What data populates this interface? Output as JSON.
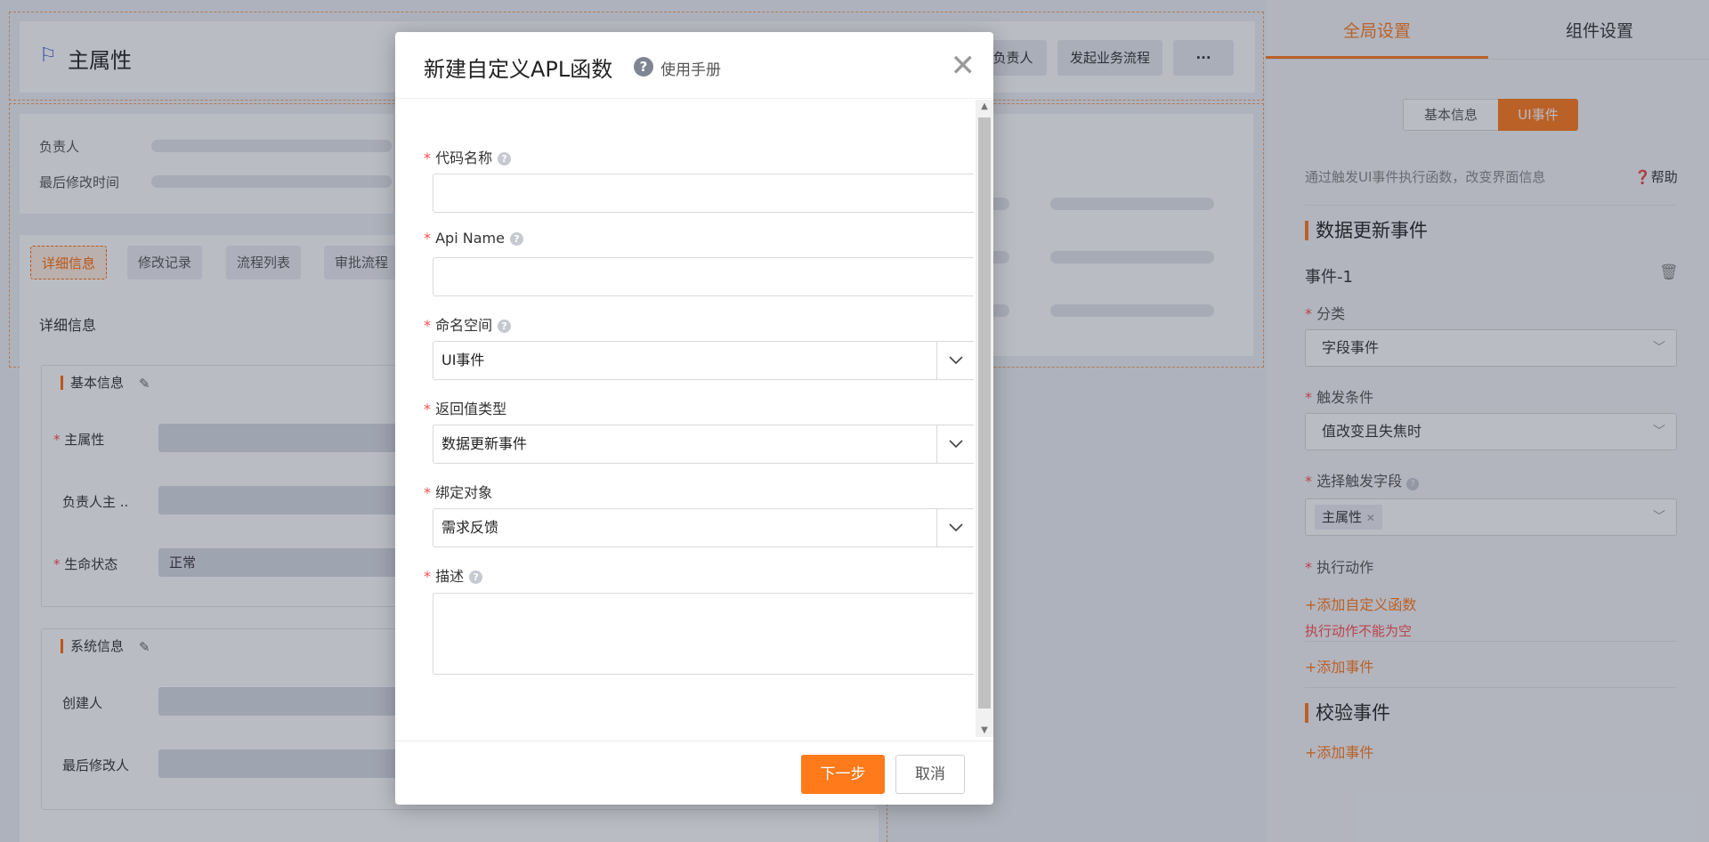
{
  "header": {
    "title": "主属性",
    "buttons": [
      "负责人",
      "发起业务流程",
      "···"
    ]
  },
  "info": {
    "owner_label": "负责人",
    "modified_label": "最后修改时间"
  },
  "detail": {
    "tabs": [
      "详细信息",
      "修改记录",
      "流程列表",
      "审批流程"
    ],
    "heading": "详细信息",
    "basic_section": "基本信息",
    "basic_fields": [
      "主属性",
      "负责人主 ..",
      "生命状态"
    ],
    "status_value": "正常",
    "system_section": "系统信息",
    "system_fields": [
      "创建人",
      "最后修改人"
    ]
  },
  "right_panel": {
    "tabs": [
      "全局设置",
      "组件设置"
    ],
    "segments": [
      "基本信息",
      "UI事件"
    ],
    "hint": "通过触发UI事件执行函数，改变界面信息",
    "help": "帮助",
    "data_update_title": "数据更新事件",
    "event_name": "事件-1",
    "category_label": "分类",
    "category_value": "字段事件",
    "trigger_label": "触发条件",
    "trigger_value": "值改变且失焦时",
    "field_label": "选择触发字段",
    "field_tag": "主属性",
    "action_label": "执行动作",
    "add_function": "+添加自定义函数",
    "action_error": "执行动作不能为空",
    "add_event_1": "+添加事件",
    "validate_title": "校验事件",
    "add_event_2": "+添加事件"
  },
  "modal": {
    "title": "新建自定义APL函数",
    "help_link": "使用手册",
    "fields": {
      "code_name": {
        "label": "代码名称",
        "value": ""
      },
      "api_name": {
        "label": "Api Name",
        "value": ""
      },
      "namespace": {
        "label": "命名空间",
        "value": "UI事件"
      },
      "return_type": {
        "label": "返回值类型",
        "value": "数据更新事件"
      },
      "bind_object": {
        "label": "绑定对象",
        "value": "需求反馈"
      },
      "description": {
        "label": "描述",
        "value": ""
      }
    },
    "next_button": "下一步",
    "cancel_button": "取消"
  }
}
